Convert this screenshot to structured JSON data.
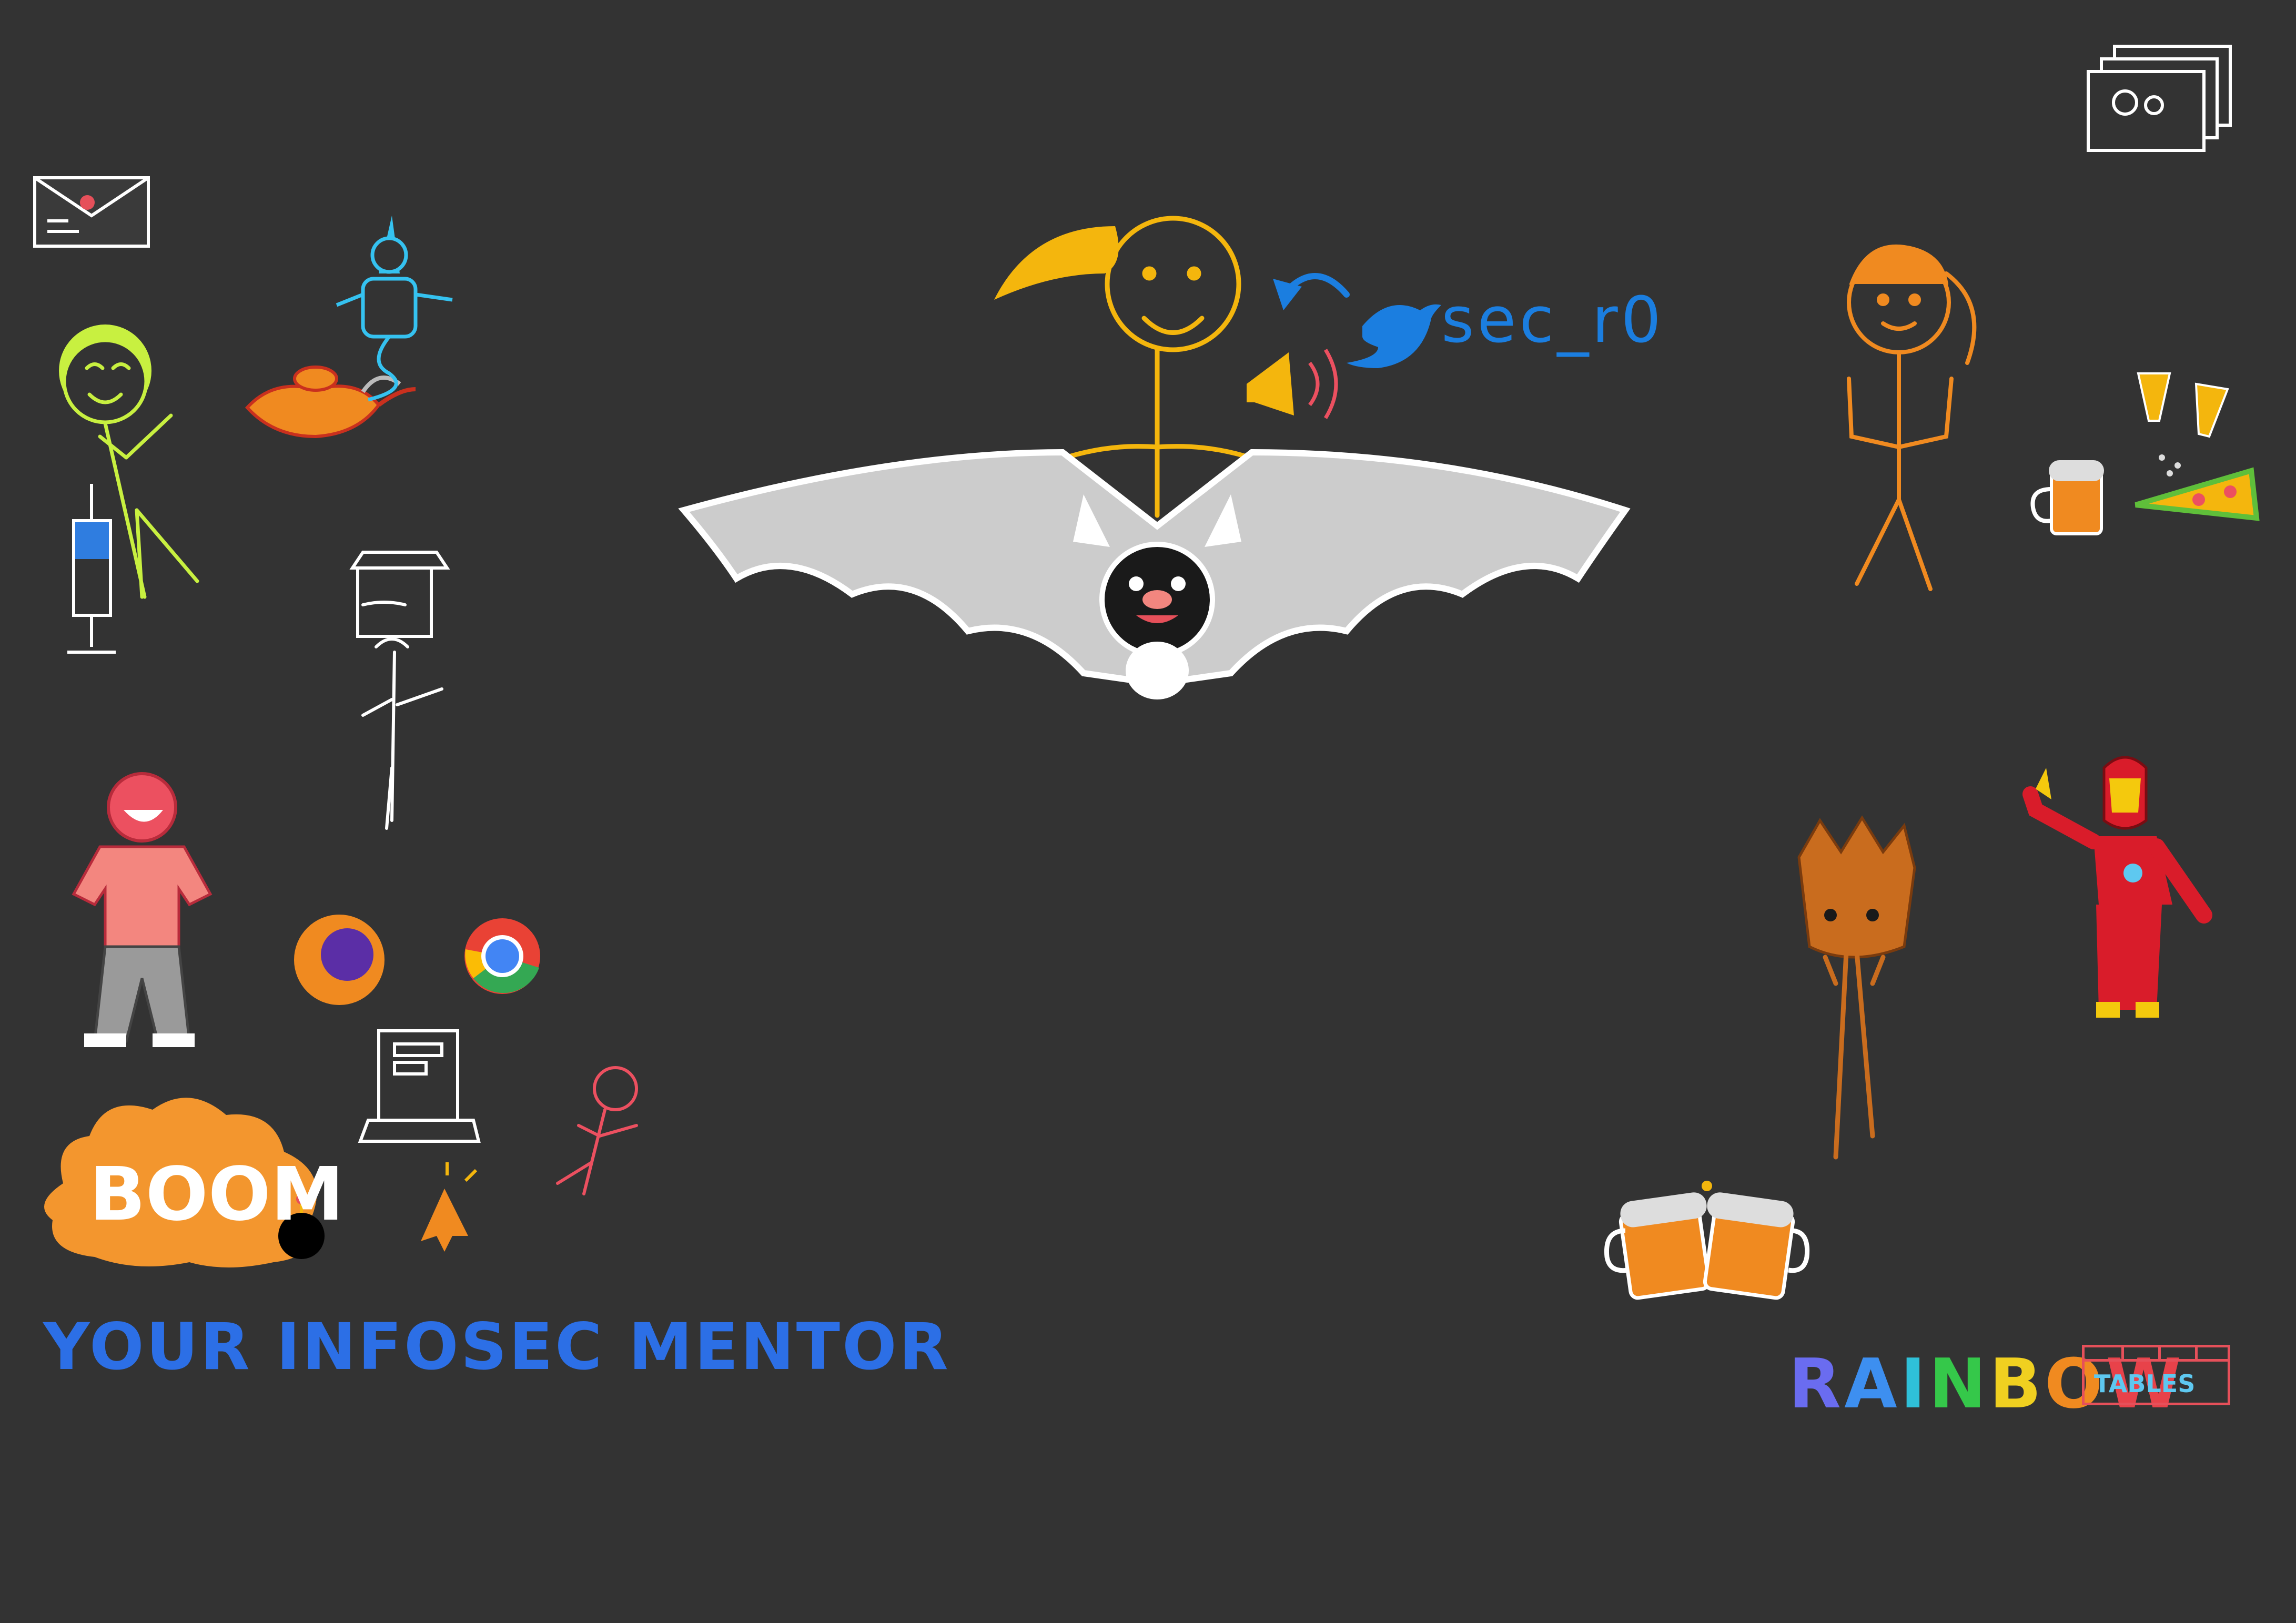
{
  "handle": "sec_r0",
  "tagline": "YOUR INFOSEC MENTOR",
  "boom": "BOOM",
  "rainbow_letters": [
    "R",
    "A",
    "I",
    "N",
    "B",
    "O",
    "W"
  ],
  "rainbow_colors": [
    "#6a6cf0",
    "#3d8ff0",
    "#2fc0d8",
    "#35c84a",
    "#f0d020",
    "#f08a20",
    "#e8424a"
  ],
  "tables_label": "TABLES",
  "colors": {
    "background": "#333333",
    "handle": "#1b7ee0",
    "tagline": "#2c6fe6",
    "boom_cloud": "#f3962e",
    "yellow_figure": "#f4b60d",
    "bat_wing": "#cccccc"
  },
  "icons": [
    "envelope-icon",
    "genie-icon",
    "magic-lamp-icon",
    "syringe-icon",
    "spy-figure-icon",
    "firefox-icon",
    "chrome-icon",
    "laptop-icon",
    "cursor-icon",
    "bomb-icon",
    "bat-icon",
    "twitter-bird-icon",
    "megaphone-icon",
    "beer-mug-icon",
    "pizza-icon",
    "salt-shaker-icon",
    "groot-icon",
    "iron-man-icon",
    "photos-icon"
  ]
}
